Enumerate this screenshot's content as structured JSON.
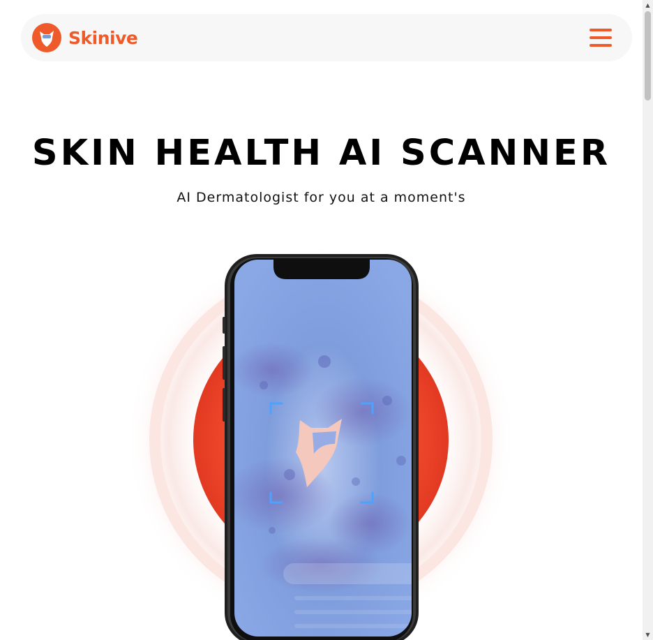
{
  "header": {
    "logo_text": "Skinive",
    "menu_icon": "hamburger-menu-icon"
  },
  "hero": {
    "title": "SKIN HEALTH AI SCANNER",
    "subtitle": "AI Dermatologist for you at a moment's"
  },
  "colors": {
    "brand": "#ef5a2b",
    "ring": "#e8432a",
    "screen_blue": "#7b9ad8"
  },
  "scrollbar": {
    "up_icon": "triangle-up-icon",
    "down_icon": "triangle-down-icon"
  }
}
